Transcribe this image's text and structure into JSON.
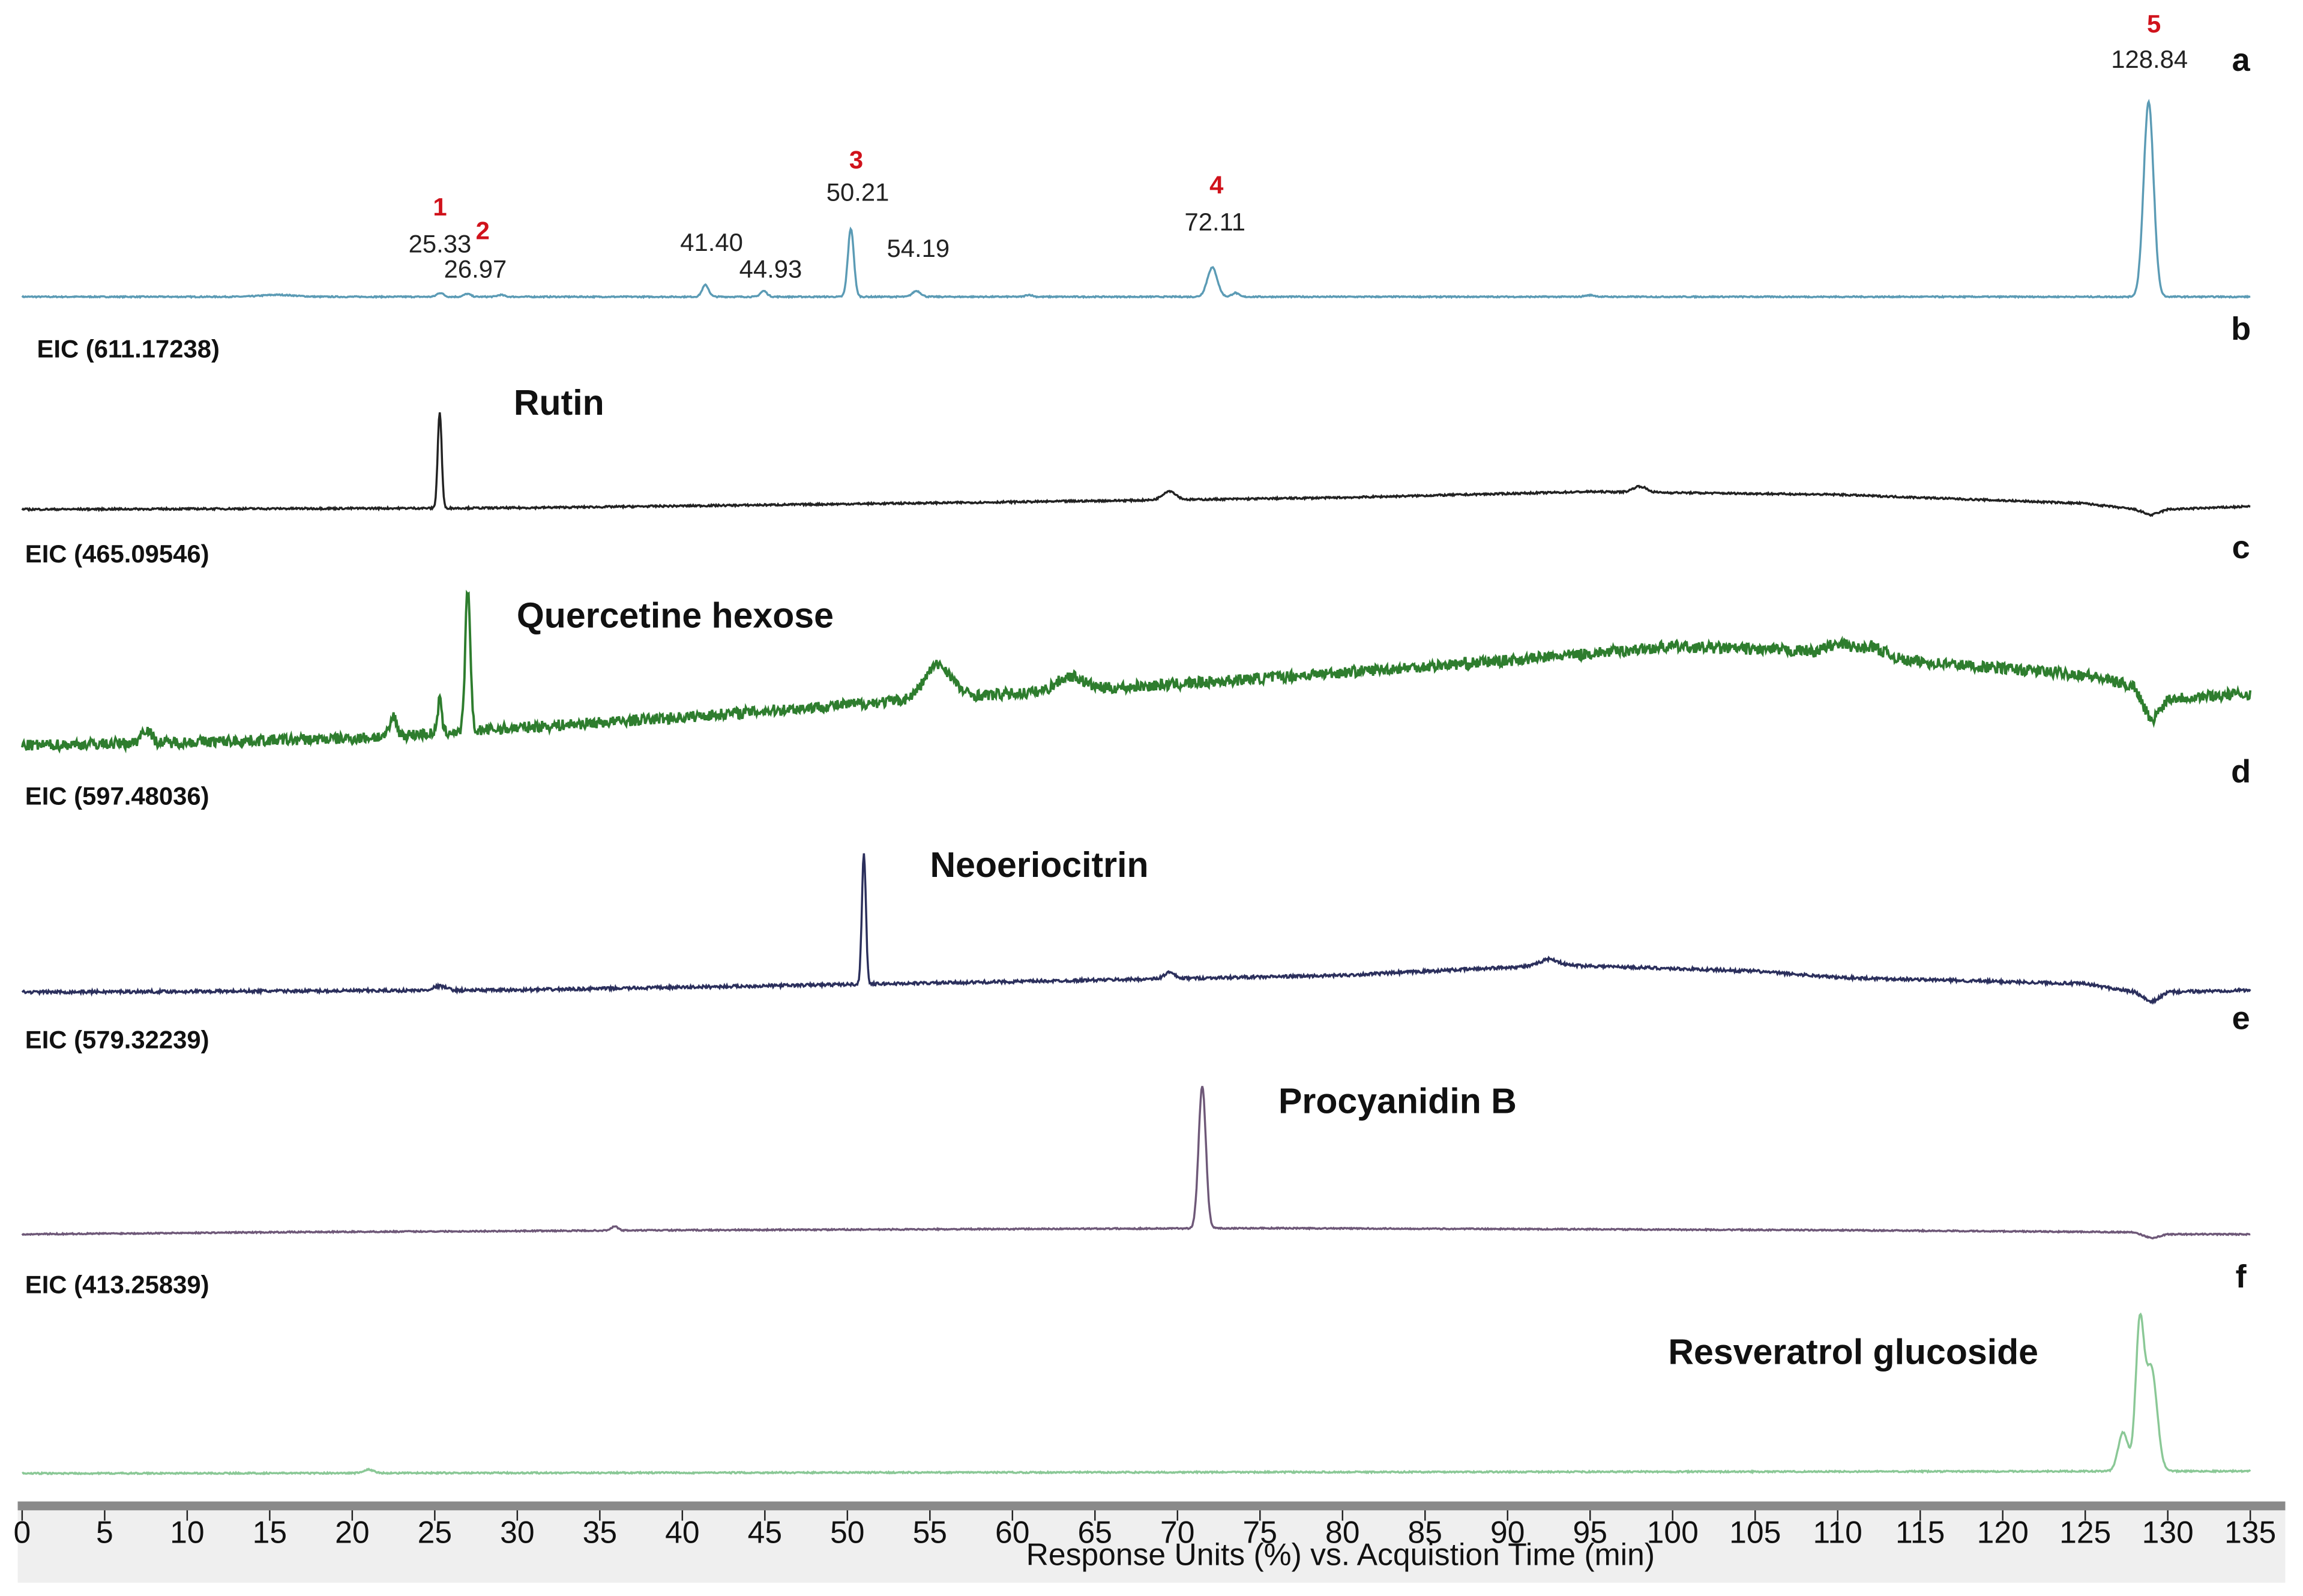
{
  "chart_data": {
    "type": "line",
    "xlabel": "Response Units (%) vs. Acquistion Time (min)",
    "xlim": [
      0,
      135
    ],
    "xticks": [
      0,
      5,
      10,
      15,
      20,
      25,
      30,
      35,
      40,
      45,
      50,
      55,
      60,
      65,
      70,
      75,
      80,
      85,
      90,
      95,
      100,
      105,
      110,
      115,
      120,
      125,
      130,
      135
    ],
    "panels": [
      {
        "letter": "a",
        "eic": "",
        "compound": "",
        "color": "#5b9bb5",
        "noise": 0.3,
        "drift": [
          [
            0,
            0
          ],
          [
            135,
            0
          ]
        ],
        "peaks": [
          [
            15.5,
            1,
            1
          ],
          [
            25.33,
            2,
            0.2
          ],
          [
            26.97,
            1.5,
            0.2
          ],
          [
            29,
            1,
            0.2
          ],
          [
            41.4,
            6,
            0.2
          ],
          [
            44.93,
            3,
            0.2
          ],
          [
            50.21,
            35,
            0.18
          ],
          [
            54.19,
            3,
            0.25
          ],
          [
            61,
            1,
            0.2
          ],
          [
            72.11,
            15,
            0.3
          ],
          [
            73.5,
            2,
            0.2
          ],
          [
            95,
            0.8,
            0.3
          ],
          [
            128.84,
            100,
            0.3
          ]
        ],
        "labels": [
          {
            "rt": "25.33",
            "num": "1",
            "t": 25.33
          },
          {
            "rt": "26.97",
            "num": "2",
            "t": 26.97
          },
          {
            "rt": "41.40",
            "num": "",
            "t": 41.4
          },
          {
            "rt": "44.93",
            "num": "",
            "t": 44.93
          },
          {
            "rt": "50.21",
            "num": "3",
            "t": 50.21
          },
          {
            "rt": "54.19",
            "num": "",
            "t": 54.19
          },
          {
            "rt": "72.11",
            "num": "4",
            "t": 72.11
          },
          {
            "rt": "128.84",
            "num": "5",
            "t": 128.84
          }
        ]
      },
      {
        "letter": "b",
        "eic": "EIC (611.17238)",
        "compound": "Rutin",
        "color": "#222222",
        "noise": 0.6,
        "drift": [
          [
            0,
            0
          ],
          [
            30,
            1
          ],
          [
            60,
            5
          ],
          [
            80,
            8
          ],
          [
            95,
            12
          ],
          [
            110,
            10
          ],
          [
            125,
            4
          ],
          [
            128,
            0
          ],
          [
            129,
            -4
          ],
          [
            130,
            0
          ],
          [
            135,
            2
          ]
        ],
        "peaks": [
          [
            25.3,
            65,
            0.12
          ],
          [
            69.5,
            6,
            0.4
          ],
          [
            98,
            4,
            0.4
          ]
        ]
      },
      {
        "letter": "c",
        "eic": "EIC (465.09546)",
        "compound": "Quercetine hexose",
        "color": "#2e7d2e",
        "noise": 2.4,
        "drift": [
          [
            0,
            0
          ],
          [
            20,
            3
          ],
          [
            40,
            12
          ],
          [
            55,
            20
          ],
          [
            70,
            26
          ],
          [
            90,
            36
          ],
          [
            100,
            42
          ],
          [
            108,
            40
          ],
          [
            110,
            32
          ],
          [
            112,
            42
          ],
          [
            114,
            36
          ],
          [
            125,
            30
          ],
          [
            128,
            25
          ],
          [
            129,
            10
          ],
          [
            130,
            20
          ],
          [
            135,
            22
          ]
        ],
        "peaks": [
          [
            7.5,
            6,
            0.3
          ],
          [
            22.5,
            8,
            0.2
          ],
          [
            25.3,
            14,
            0.12
          ],
          [
            27.0,
            60,
            0.15
          ],
          [
            55.5,
            14,
            0.8
          ],
          [
            63.5,
            6,
            0.8
          ],
          [
            110,
            10,
            0.8
          ]
        ]
      },
      {
        "letter": "d",
        "eic": "EIC (597.48036)",
        "compound": "Neoeriocitrin",
        "color": "#2b2f5c",
        "noise": 0.7,
        "drift": [
          [
            0,
            0
          ],
          [
            30,
            1
          ],
          [
            60,
            5
          ],
          [
            80,
            8
          ],
          [
            93,
            13
          ],
          [
            105,
            10
          ],
          [
            110,
            7
          ],
          [
            125,
            4
          ],
          [
            128,
            0
          ],
          [
            129,
            -5
          ],
          [
            130,
            0
          ],
          [
            135,
            1
          ]
        ],
        "peaks": [
          [
            25.3,
            2,
            0.4
          ],
          [
            51.0,
            63,
            0.12
          ],
          [
            69.5,
            3,
            0.3
          ],
          [
            92.5,
            3,
            0.5
          ]
        ]
      },
      {
        "letter": "e",
        "eic": "EIC (579.32239)",
        "compound": "Procyanidin B",
        "color": "#6e5878",
        "noise": 0.3,
        "drift": [
          [
            0,
            0
          ],
          [
            15,
            1
          ],
          [
            40,
            2
          ],
          [
            75,
            3
          ],
          [
            110,
            2
          ],
          [
            128,
            1
          ],
          [
            129,
            -2
          ],
          [
            130,
            0
          ],
          [
            135,
            0
          ]
        ],
        "peaks": [
          [
            35.9,
            2,
            0.2
          ],
          [
            71.5,
            70,
            0.22
          ]
        ]
      },
      {
        "letter": "f",
        "eic": "EIC (413.25839)",
        "compound": "Resveratrol glucoside",
        "color": "#8ac896",
        "noise": 0.3,
        "drift": [
          [
            0,
            0
          ],
          [
            135,
            1
          ]
        ],
        "peaks": [
          [
            21,
            1.5,
            0.3
          ],
          [
            127.3,
            17,
            0.3
          ],
          [
            128.3,
            62,
            0.25
          ],
          [
            129.0,
            45,
            0.35
          ]
        ]
      }
    ]
  }
}
